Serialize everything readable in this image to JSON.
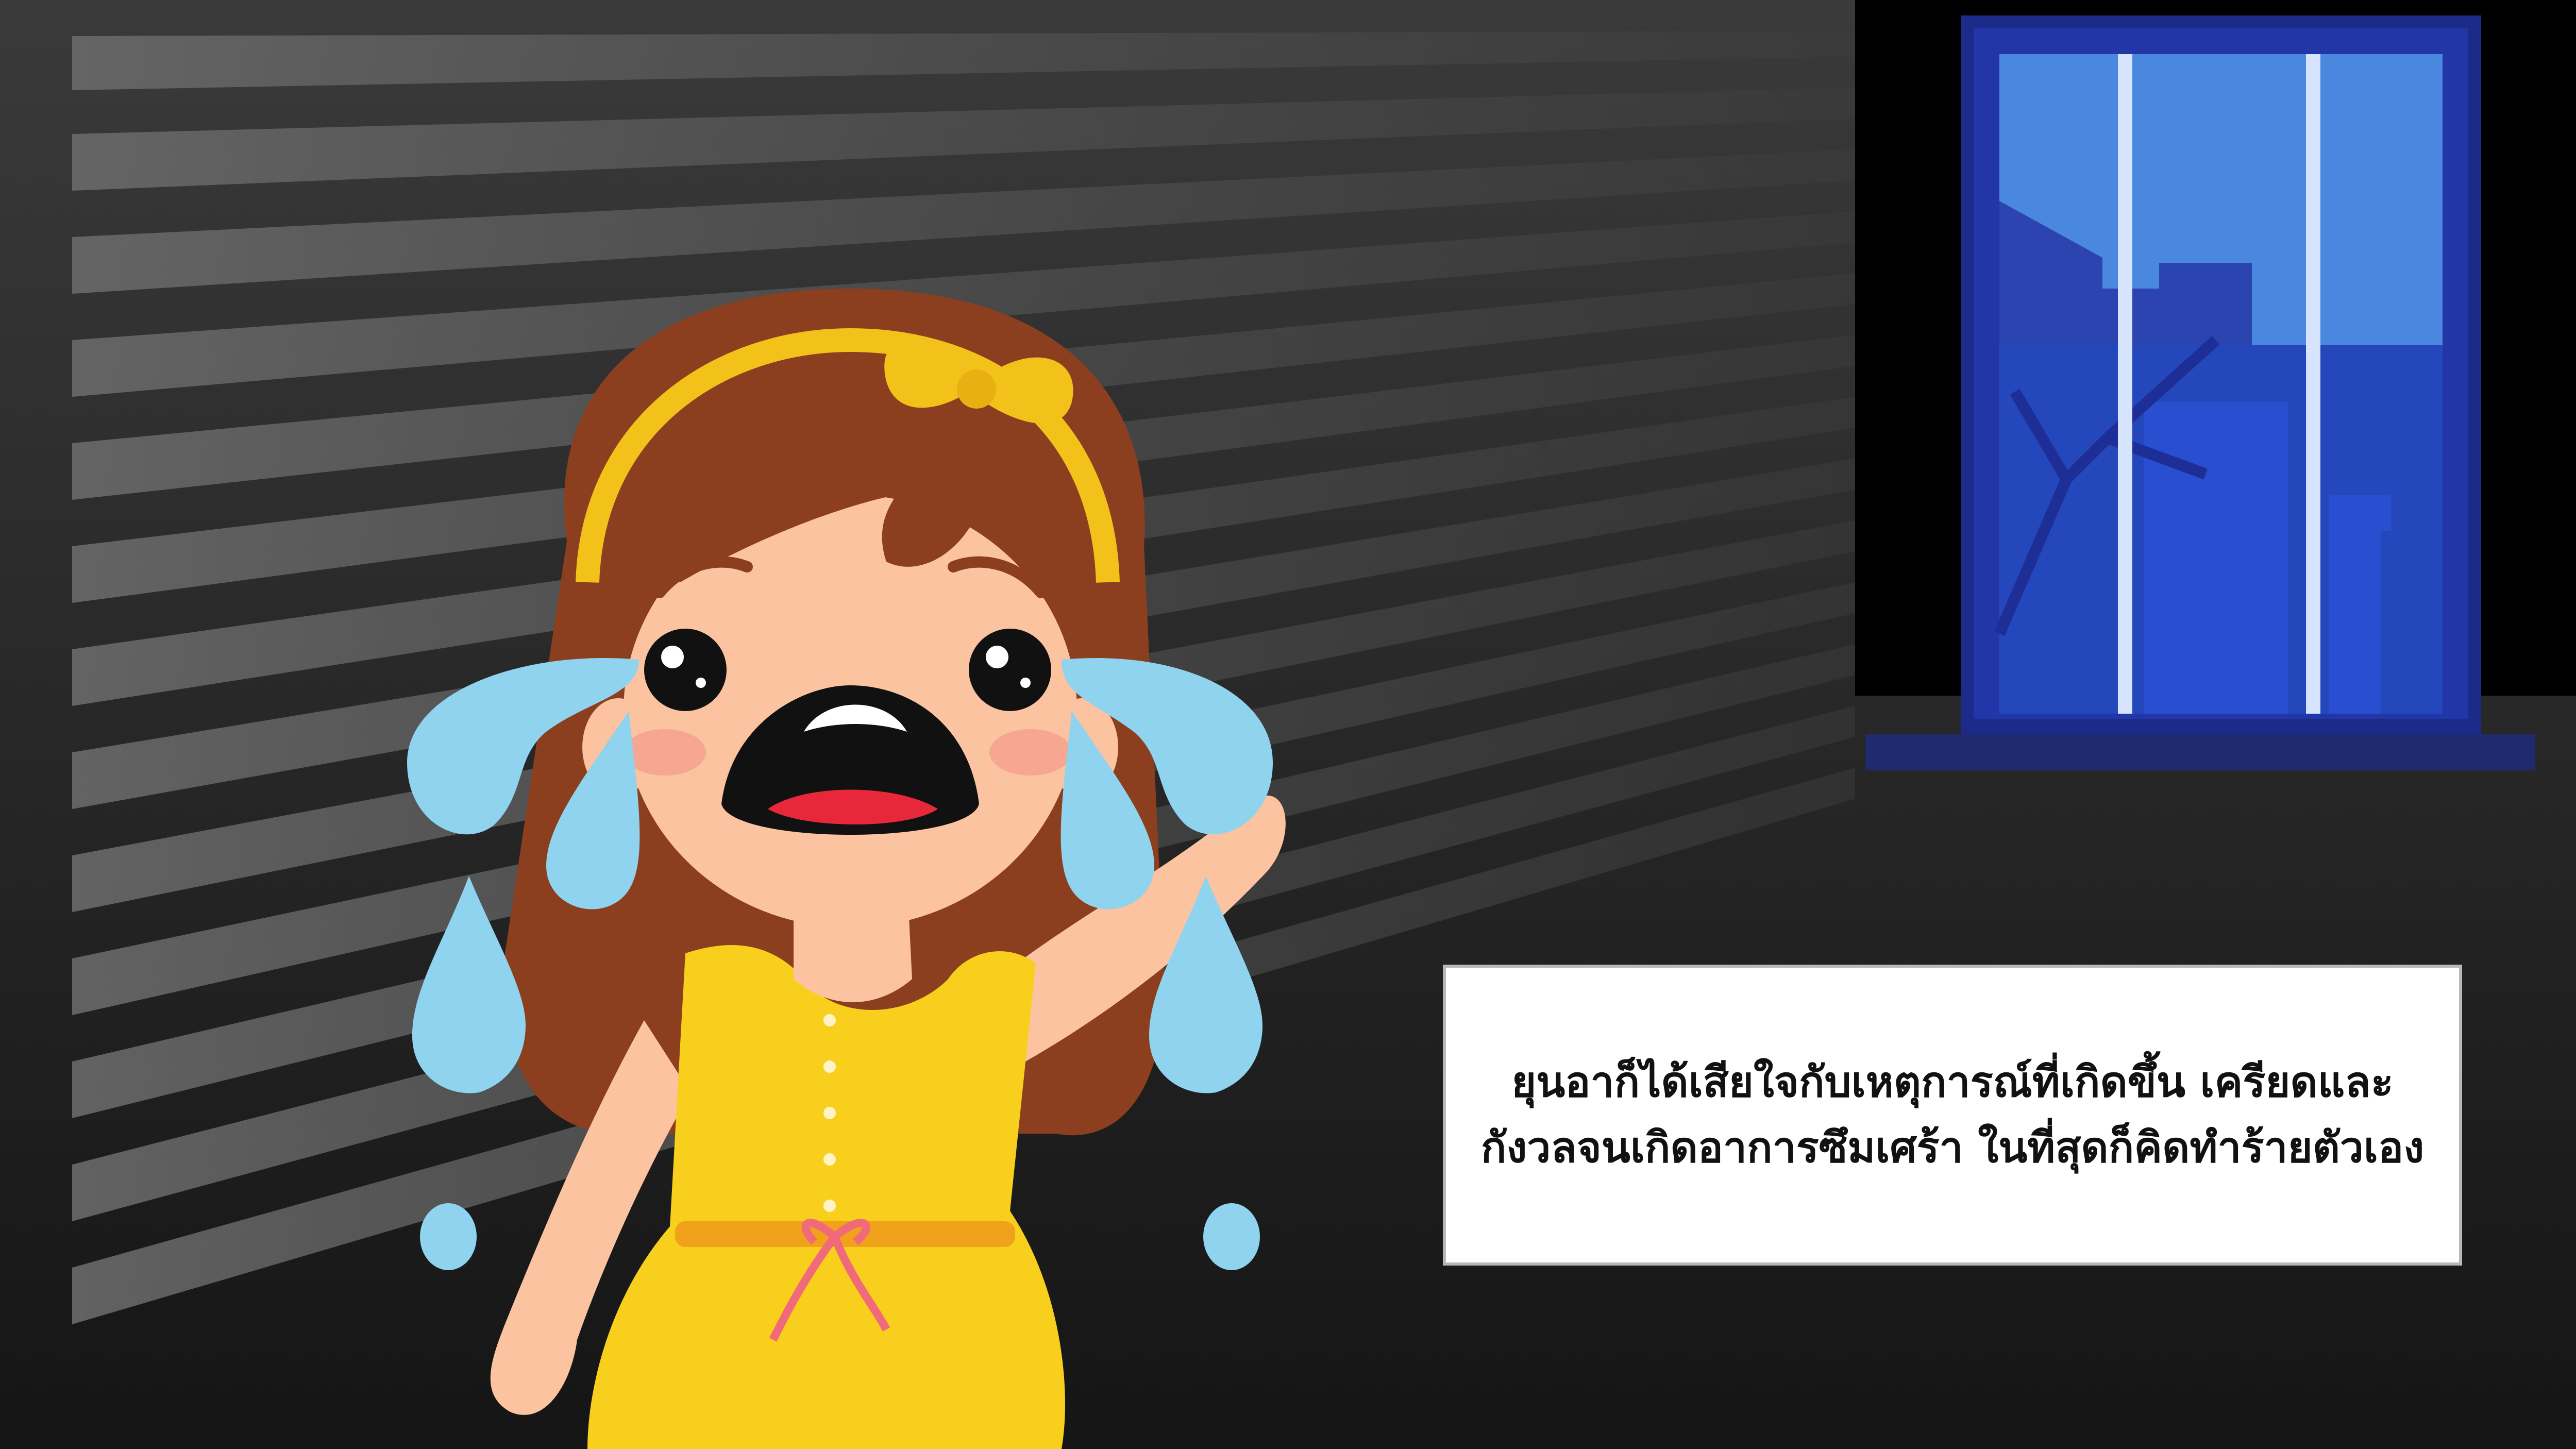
{
  "scene": {
    "character": "crying-girl",
    "window": "night-window",
    "colors": {
      "background": "#1b1b1b",
      "light_rays": "#5a5a5a",
      "wall_dark": "#000000",
      "window_frame": "#1c2a8a",
      "window_glass": "#4a88e0",
      "city_silhouette": "#2445b8",
      "hair": "#8b3f1f",
      "headband": "#f2c21a",
      "dress": "#f7cf1c",
      "skin": "#fcc3a0",
      "tears": "#8fd3ef"
    }
  },
  "caption": {
    "line1": "ยุนอาก็ได้เสียใจกับเหตุการณ์ที่เกิดขึ้น เครียดและ",
    "line2": "กังวลจนเกิดอาการซึมเศร้า ในที่สุดก็คิดทำร้ายตัวเอง"
  }
}
